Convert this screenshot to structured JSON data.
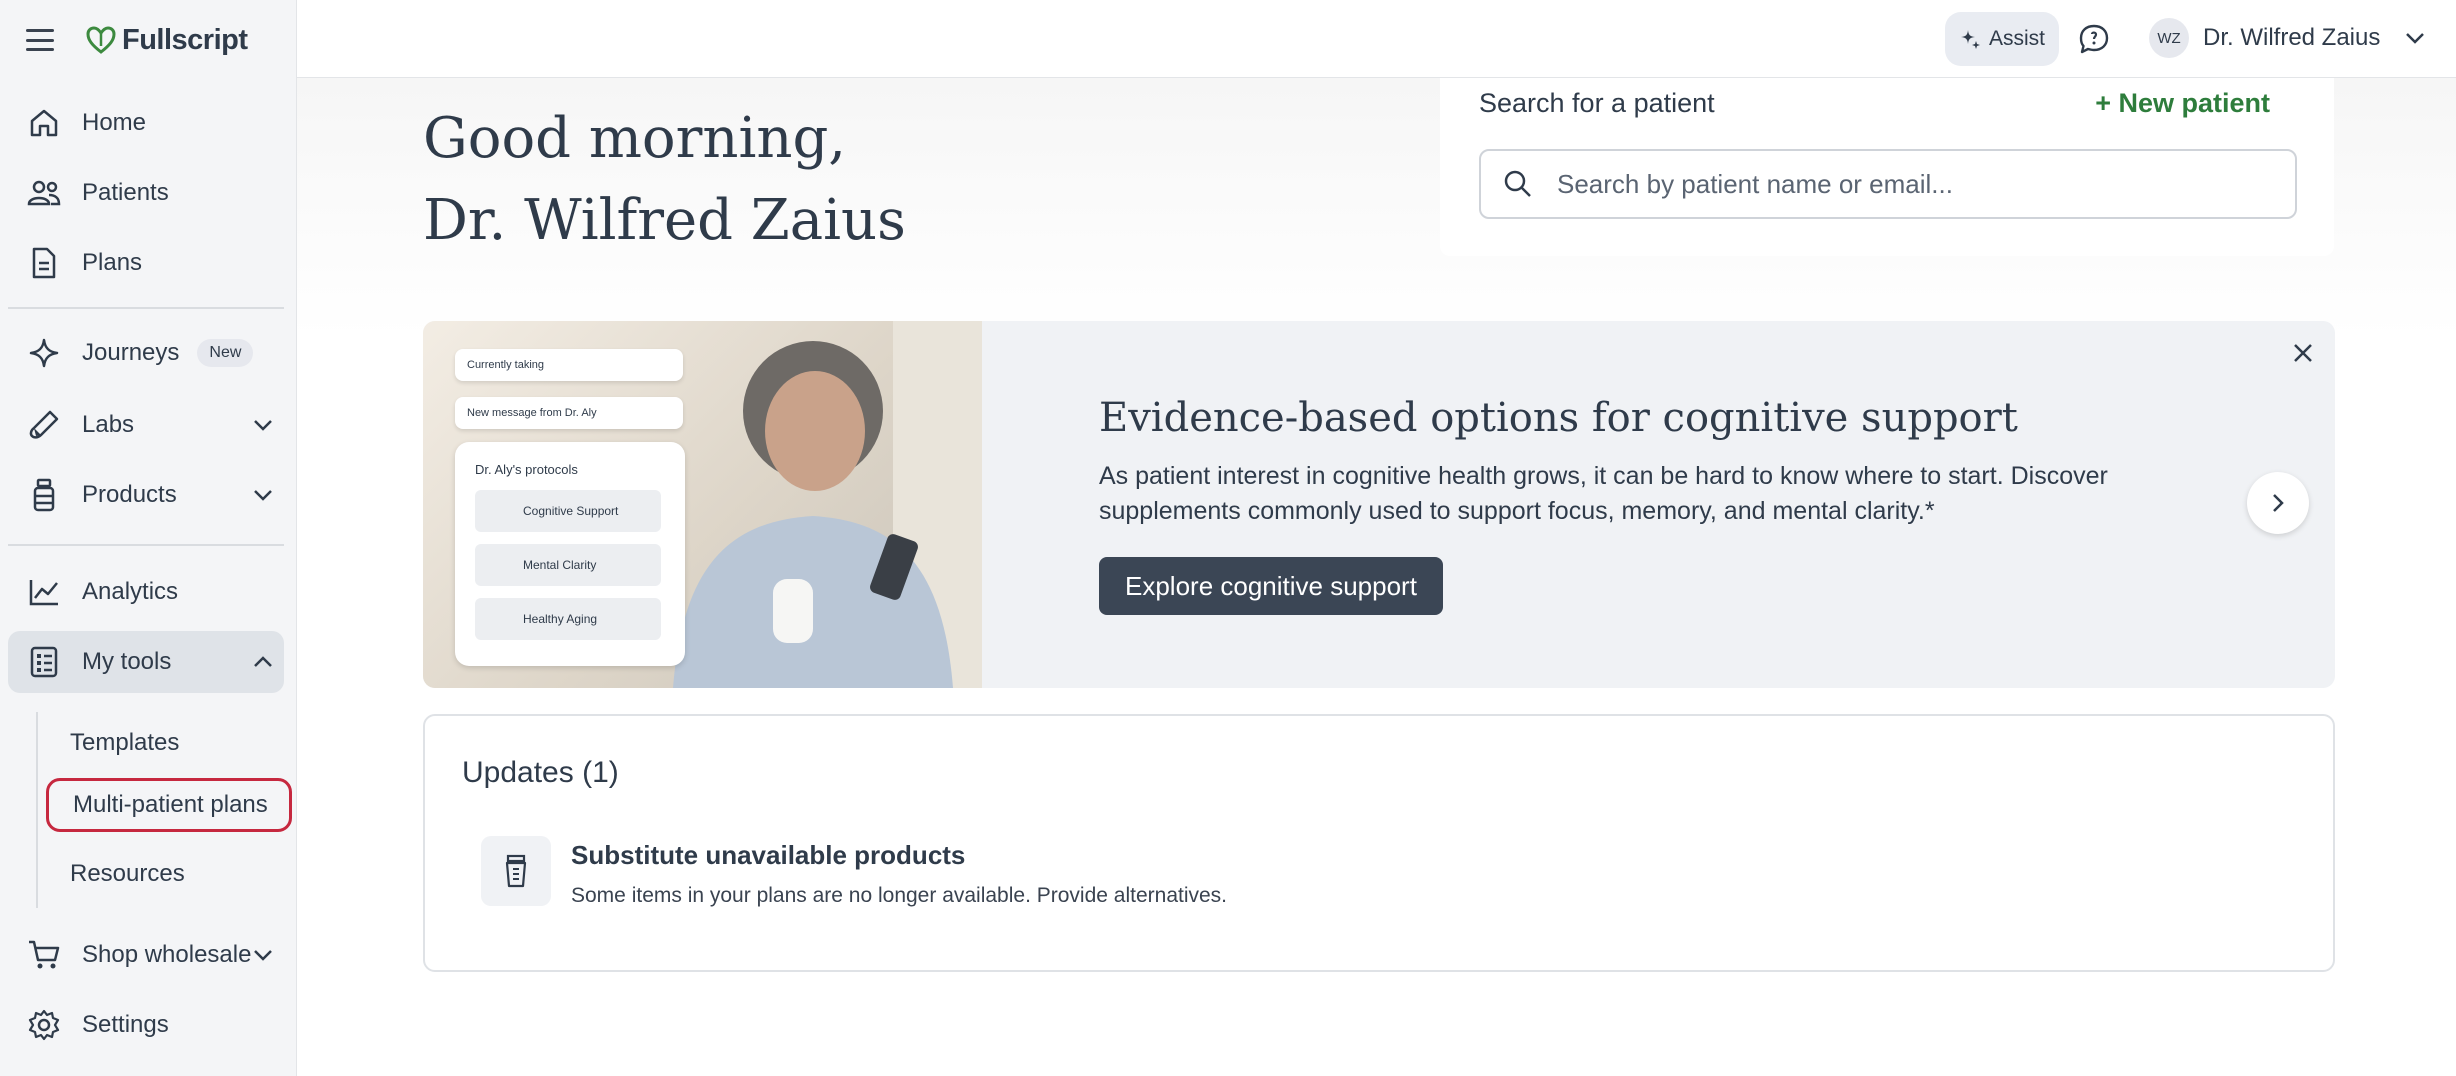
{
  "brand": {
    "name": "Fullscript"
  },
  "sidebar": {
    "items": [
      {
        "label": "Home",
        "icon": "home-icon"
      },
      {
        "label": "Patients",
        "icon": "patients-icon"
      },
      {
        "label": "Plans",
        "icon": "document-icon"
      },
      {
        "label": "Journeys",
        "icon": "sparkle-icon",
        "badge": "New"
      },
      {
        "label": "Labs",
        "icon": "dropper-icon"
      },
      {
        "label": "Products",
        "icon": "bottle-icon"
      },
      {
        "label": "Analytics",
        "icon": "chart-line-icon"
      },
      {
        "label": "My tools",
        "icon": "checklist-icon"
      },
      {
        "label": "Shop wholesale",
        "icon": "cart-icon"
      },
      {
        "label": "Settings",
        "icon": "gear-icon"
      }
    ],
    "my_tools_sub": [
      "Templates",
      "Multi-patient plans",
      "Resources"
    ],
    "active_item": "My tools"
  },
  "topbar": {
    "assist_label": "Assist",
    "user_initials": "WZ",
    "user_name": "Dr. Wilfred Zaius"
  },
  "main": {
    "greeting_line1": "Good morning,",
    "greeting_line2": "Dr. Wilfred Zaius",
    "search": {
      "title": "Search for a patient",
      "new_patient": "+ New patient",
      "placeholder": "Search by patient name or email..."
    },
    "banner": {
      "title": "Evidence-based options for cognitive support",
      "body": "As patient interest in cognitive health grows, it can be hard to know where to start. Discover supplements commonly used to support focus, memory, and mental clarity.*",
      "cta": "Explore cognitive support",
      "mock": {
        "pill1": "Currently taking",
        "pill2": "New message from Dr. Aly",
        "card_title": "Dr. Aly's protocols",
        "rows": [
          "Cognitive Support",
          "Mental Clarity",
          "Healthy Aging"
        ]
      }
    },
    "updates": {
      "title": "Updates (1)",
      "item_title": "Substitute unavailable products",
      "item_desc": "Some items in your plans are no longer available. Provide alternatives."
    }
  },
  "colors": {
    "accent_green": "#2e7d3c",
    "annotation_red": "#c6283f",
    "button_dark": "#3b4655"
  }
}
